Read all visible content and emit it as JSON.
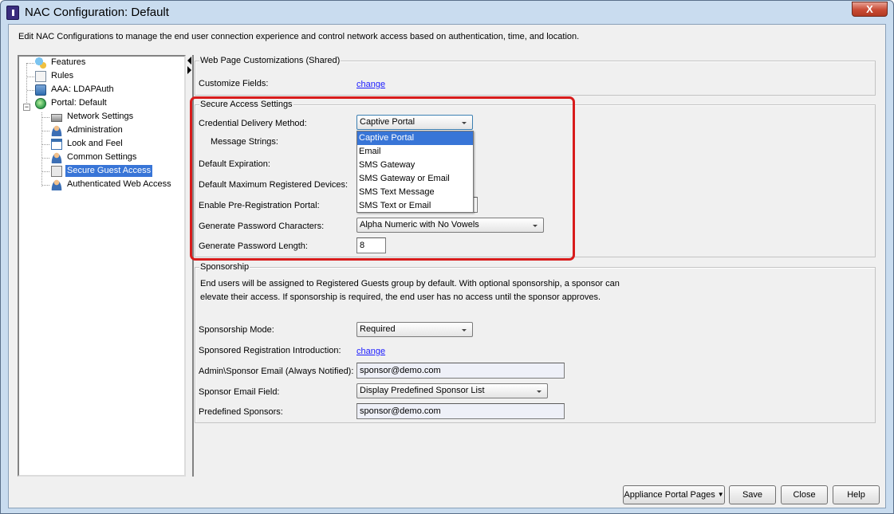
{
  "window": {
    "title": "NAC Configuration: Default",
    "close_glyph": "X"
  },
  "description": "Edit NAC Configurations to manage the end user connection experience and control network access based on authentication, time, and location.",
  "tree": {
    "expander_glyph": "−",
    "items": [
      {
        "label": "Features",
        "icon": "features-icon"
      },
      {
        "label": "Rules",
        "icon": "rules-icon"
      },
      {
        "label": "AAA: LDAPAuth",
        "icon": "ldap-icon"
      },
      {
        "label": "Portal: Default",
        "icon": "globe-icon"
      },
      {
        "label": "Network Settings",
        "icon": "network-icon"
      },
      {
        "label": "Administration",
        "icon": "admin-person-icon"
      },
      {
        "label": "Look and Feel",
        "icon": "look-feel-icon"
      },
      {
        "label": "Common Settings",
        "icon": "common-settings-icon"
      },
      {
        "label": "Secure Guest Access",
        "icon": "secure-guest-icon",
        "selected": true
      },
      {
        "label": "Authenticated Web Access",
        "icon": "auth-web-icon"
      }
    ]
  },
  "web_page": {
    "title": "Web Page Customizations (Shared)",
    "customize_fields_label": "Customize Fields:",
    "customize_fields_link": "change"
  },
  "secure_access": {
    "title": "Secure Access Settings",
    "credential_delivery_label": "Credential Delivery Method:",
    "credential_delivery_value": "Captive Portal",
    "message_strings_label": "Message Strings:",
    "default_expiration_label": "Default Expiration:",
    "default_max_devices_label": "Default Maximum Registered Devices:",
    "enable_prereg_label": "Enable Pre-Registration Portal:",
    "generate_pw_chars_label": "Generate Password Characters:",
    "generate_pw_chars_value": "Alpha Numeric with No Vowels",
    "generate_pw_length_label": "Generate Password Length:",
    "generate_pw_length_value": "8",
    "dropdown_options": [
      "Captive Portal",
      "Email",
      "SMS Gateway",
      "SMS Gateway or Email",
      "SMS Text Message",
      "SMS Text or Email"
    ],
    "dropdown_selected_index": 0
  },
  "sponsorship": {
    "title": "Sponsorship",
    "description_line1": "End users will be assigned to Registered Guests group by default. With optional sponsorship, a sponsor can",
    "description_line2": "elevate their access. If sponsorship is required, the end user has no access until the sponsor approves.",
    "mode_label": "Sponsorship Mode:",
    "mode_value": "Required",
    "intro_label": "Sponsored Registration Introduction:",
    "intro_link": "change",
    "admin_email_label": "Admin\\Sponsor Email (Always Notified):",
    "admin_email_value": "sponsor@demo.com",
    "email_field_label": "Sponsor Email Field:",
    "email_field_value": "Display Predefined Sponsor List",
    "predefined_label": "Predefined Sponsors:",
    "predefined_value": "sponsor@demo.com"
  },
  "footer": {
    "appliance_portal_pages": "Appliance Portal Pages",
    "save": "Save",
    "close": "Close",
    "help": "Help"
  },
  "colors": {
    "selection": "#3875d7",
    "annotation": "#d81c1c",
    "link": "#1a1aff"
  }
}
